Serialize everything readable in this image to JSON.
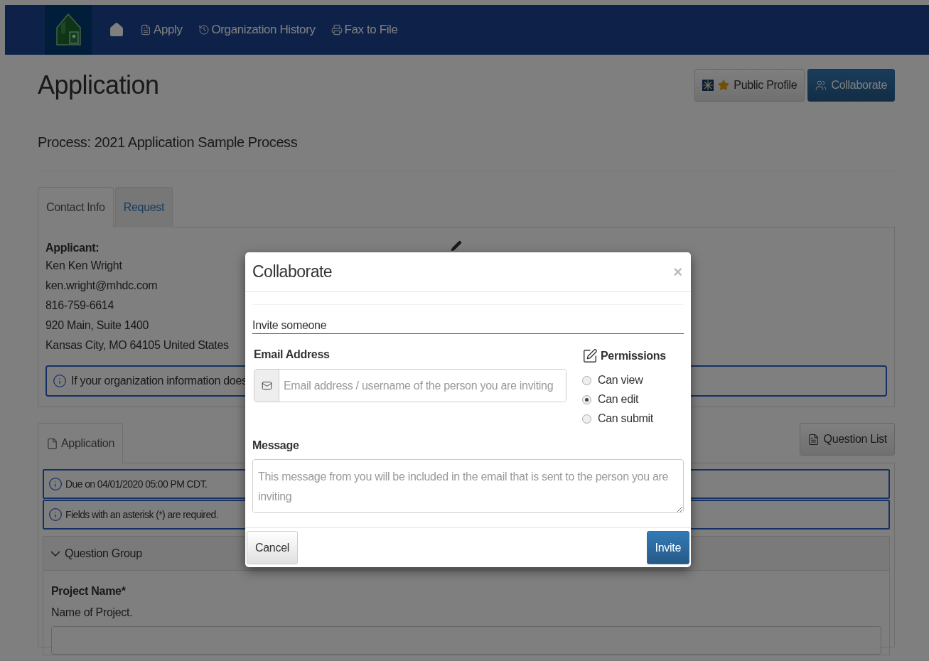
{
  "nav": {
    "items": [
      {
        "kind": "home"
      },
      {
        "kind": "file",
        "label": "Apply"
      },
      {
        "kind": "history",
        "label": "Organization History"
      },
      {
        "kind": "fax",
        "label": "Fax to File"
      }
    ]
  },
  "page": {
    "title": "Application",
    "header_buttons": [
      {
        "kind": "default",
        "label": "Public Profile"
      },
      {
        "kind": "primary",
        "label": "Collaborate"
      }
    ],
    "process": "Process: 2021 Application Sample Process",
    "tabs": [
      {
        "label": "Contact Info",
        "selected": true
      },
      {
        "label": "Request",
        "selected": false
      }
    ],
    "applicant": {
      "heading": "Applicant:",
      "lines": [
        "Ken Ken Wright",
        "ken.wright@mhdc.com",
        "816-759-6614",
        "920 Main, Suite 1400",
        "Kansas City, MO 64105 United States"
      ]
    },
    "org_alert": "If your organization information does",
    "app_tabs": [
      {
        "label": "Application",
        "selected": true
      }
    ],
    "question_list_button": "Question List",
    "notices": [
      "Due on 04/01/2020 05:00 PM CDT.",
      "Fields with an asterisk (*) are required."
    ],
    "question_group": {
      "title": "Question Group",
      "expanded": true
    },
    "field": {
      "label": "Project Name*",
      "hint": "Name of Project."
    }
  },
  "modal": {
    "title": "Collaborate",
    "close": "×",
    "legend": "Invite someone",
    "email_label": "Email Address",
    "email_placeholder": "Email address / username of the person you are inviting",
    "permissions_label": "Permissions",
    "permissions": [
      {
        "label": "Can view",
        "selected": false
      },
      {
        "label": "Can edit",
        "selected": true
      },
      {
        "label": "Can submit",
        "selected": false
      }
    ],
    "message_label": "Message",
    "message_placeholder": "This message from you will be included in the email that is sent to the person you are inviting",
    "buttons": [
      {
        "kind": "default",
        "label": "Cancel"
      },
      {
        "kind": "primary",
        "label": "Invite"
      }
    ]
  }
}
